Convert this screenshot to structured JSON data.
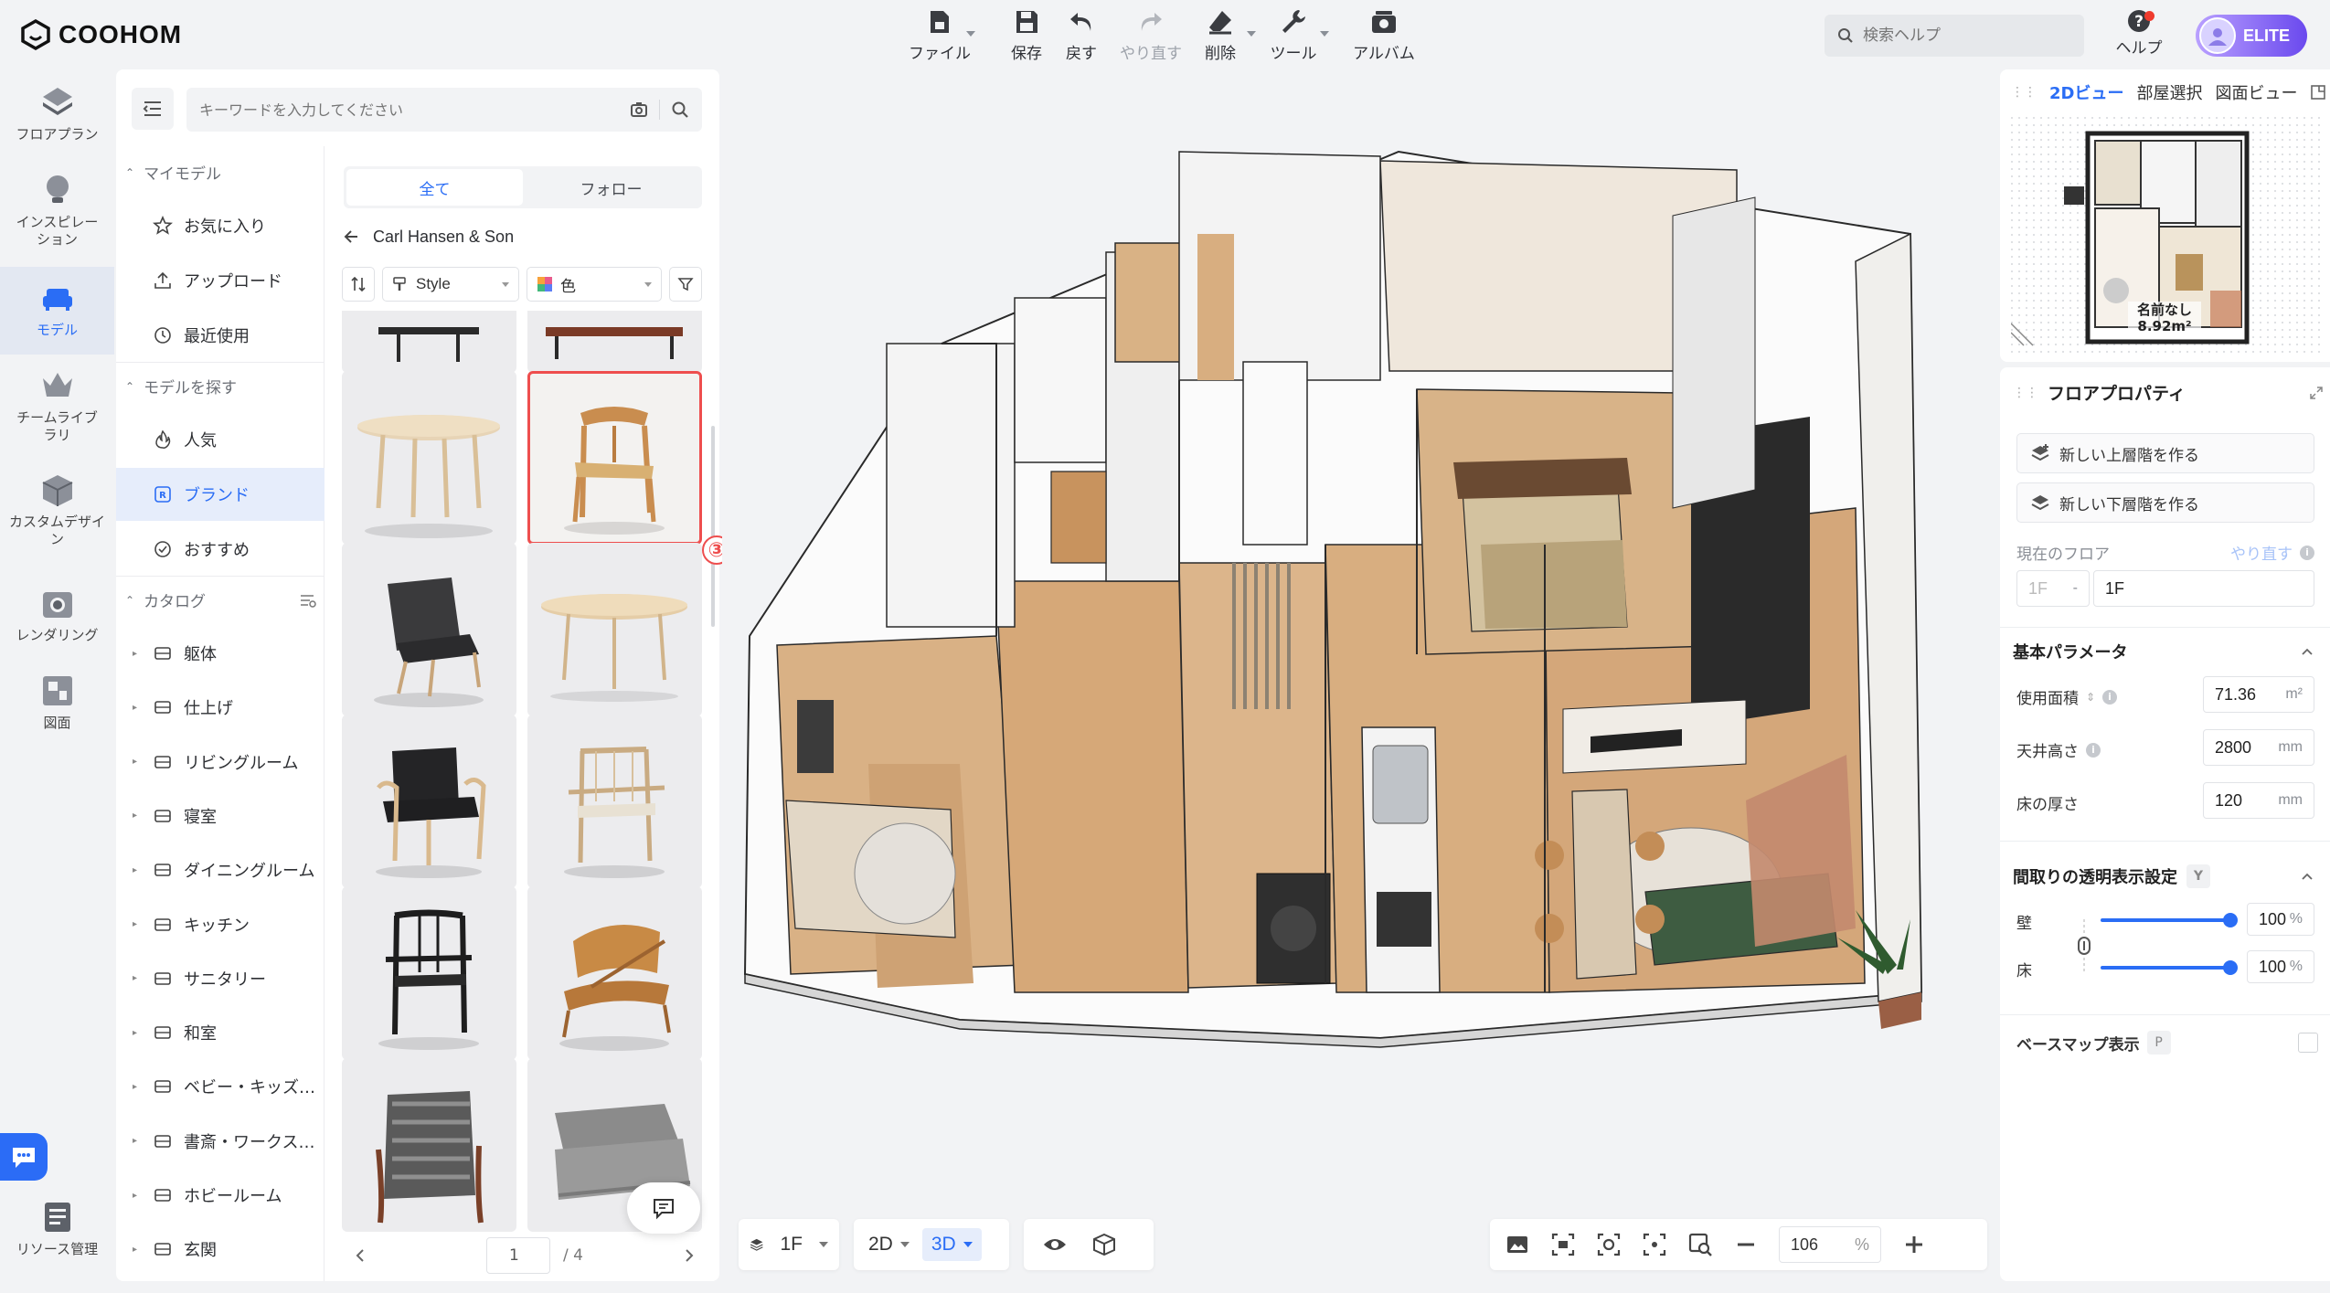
{
  "brand": {
    "name": "COOHOM"
  },
  "toolbar": {
    "file": "ファイル",
    "save": "保存",
    "undo": "戻す",
    "redo": "やり直す",
    "delete": "削除",
    "tools": "ツール",
    "album": "アルバム"
  },
  "help": {
    "search_placeholder": "検索ヘルプ",
    "label": "ヘルプ"
  },
  "account": {
    "plan": "ELITE"
  },
  "rail": {
    "floorplan": "フロアプラン",
    "inspiration": "インスピレーション",
    "model": "モデル",
    "team_library": "チームライブラリ",
    "custom_design": "カスタムデザイン",
    "rendering": "レンダリング",
    "drawings": "図面",
    "resources": "リソース管理"
  },
  "panel": {
    "search_placeholder": "キーワードを入力してください",
    "sections": {
      "my_models": "マイモデル",
      "find_models": "モデルを探す",
      "catalog": "カタログ"
    },
    "my_models": [
      "お気に入り",
      "アップロード",
      "最近使用"
    ],
    "find_models": [
      "人気",
      "ブランド",
      "おすすめ"
    ],
    "catalog": [
      "躯体",
      "仕上げ",
      "リビングルーム",
      "寝室",
      "ダイニングルーム",
      "キッチン",
      "サニタリー",
      "和室",
      "ベビー・キッズ…",
      "書斎・ワークス…",
      "ホビールーム",
      "玄関"
    ],
    "tabs": [
      "全て",
      "フォロー"
    ],
    "breadcrumb": "Carl Hansen & Son",
    "filter_style": "Style",
    "filter_color": "色",
    "badge": "③",
    "page_current": "1",
    "page_total": "/ 4"
  },
  "canvas": {
    "floor": "1F",
    "view_2d": "2D",
    "view_3d": "3D",
    "zoom": "106",
    "zoom_unit": "%"
  },
  "right": {
    "tabs": [
      "2Dビュー",
      "部屋選択",
      "図面ビュー"
    ],
    "minimap_label": "名前なし",
    "minimap_area": "8.92m²",
    "floor_props": "フロアプロパティ",
    "new_upper": "新しい上層階を作る",
    "new_lower": "新しい下層階を作る",
    "current_floor": "現在のフロア",
    "redo": "やり直す",
    "floor_prefix": "1F",
    "floor_name": "1F",
    "basic_params": "基本パラメータ",
    "area_label": "使用面積",
    "area_value": "71.36",
    "area_unit": "m²",
    "ceiling_label": "天井高さ",
    "ceiling_value": "2800",
    "ceiling_unit": "mm",
    "floor_thick_label": "床の厚さ",
    "floor_thick_value": "120",
    "floor_thick_unit": "mm",
    "transparency_title": "間取りの透明表示設定",
    "transparency_key": "Y",
    "wall_label": "壁",
    "wall_value": "100",
    "floor_label": "床",
    "floor_value": "100",
    "percent": "%",
    "basemap_label": "ベースマップ表示",
    "basemap_key": "P",
    "wall_level": 1.0,
    "floor_level": 1.0
  },
  "colors": {
    "accent": "#2a6df5",
    "selection": "#ee4e4e",
    "elite": "#6a49ee"
  }
}
